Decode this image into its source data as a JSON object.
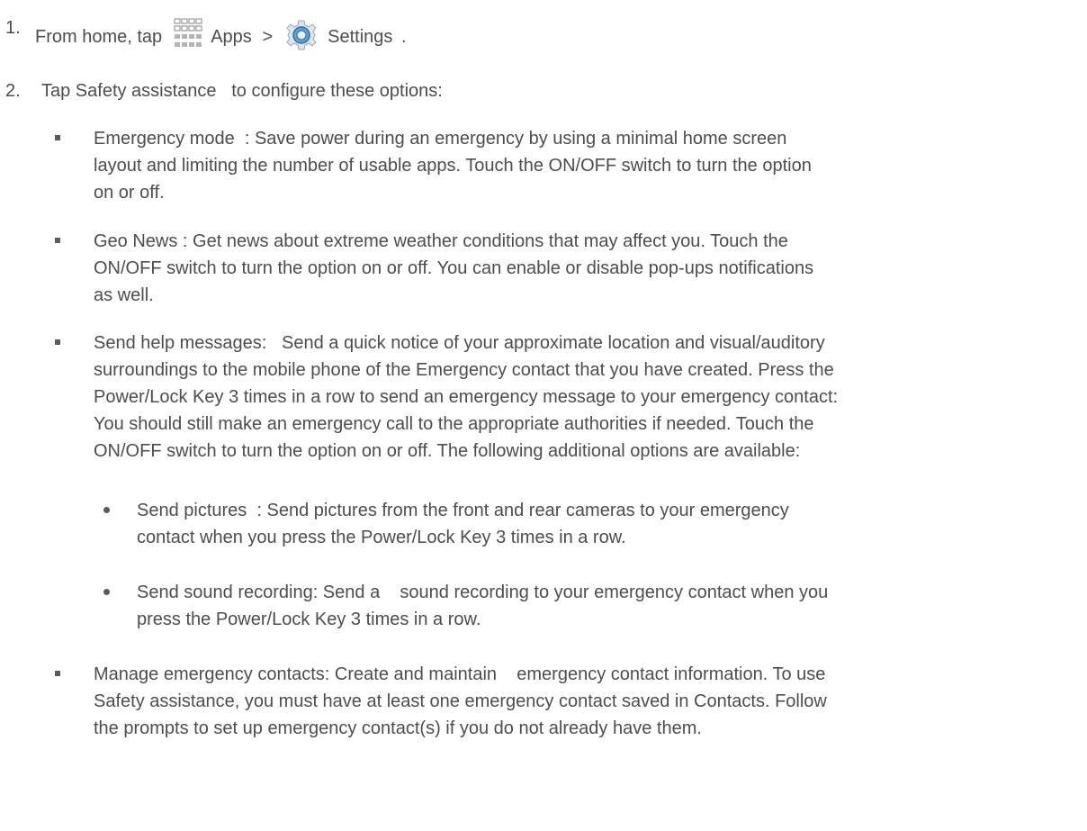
{
  "step1": {
    "number": "1.",
    "prefix": "From home, tap",
    "apps_label": "Apps",
    "separator": ">",
    "settings_label": "Settings",
    "suffix": ".",
    "apps_icon": "apps-grid-icon",
    "settings_icon": "settings-gear-icon"
  },
  "step2": {
    "number": "2.",
    "text": "Tap Safety assistance   to configure these options:"
  },
  "items": {
    "emergency_mode": {
      "lines": [
        "Emergency mode  : Save power during an emergency by using a minimal home screen",
        "layout and limiting the number of usable apps. Touch the ON/OFF switch to turn the option",
        "on or off."
      ]
    },
    "geo_news": {
      "lines": [
        "Geo News : Get news about extreme weather conditions that may affect you. Touch the",
        "ON/OFF switch to turn the option on or off. You can enable or disable pop-ups notifications",
        "as well."
      ]
    },
    "send_help": {
      "lines": [
        "Send help messages:   Send a quick notice of your approximate location and visual/auditory",
        "surroundings to the mobile phone of the Emergency contact that you have created. Press the",
        "Power/Lock Key 3 times in a row to send an emergency message to your emergency contact:",
        "You should still make an emergency call to the appropriate authorities if needed. Touch the",
        "ON/OFF switch to turn the option on or off. The following additional options are available:"
      ],
      "sub_items": {
        "send_pictures": {
          "lines": [
            "Send pictures  : Send pictures from the front and rear cameras to your emergency",
            "contact when you press the Power/Lock Key 3 times in a row."
          ]
        },
        "send_sound": {
          "lines": [
            "Send sound recording: Send a    sound recording to your emergency contact when you",
            "press the Power/Lock Key 3 times in a row."
          ]
        }
      }
    },
    "manage_contacts": {
      "lines": [
        "Manage emergency contacts: Create and maintain    emergency contact information. To use",
        "Safety assistance, you must have at least one emergency contact saved in Contacts. Follow",
        "the prompts to set up emergency contact(s) if you do not already have them."
      ]
    }
  }
}
